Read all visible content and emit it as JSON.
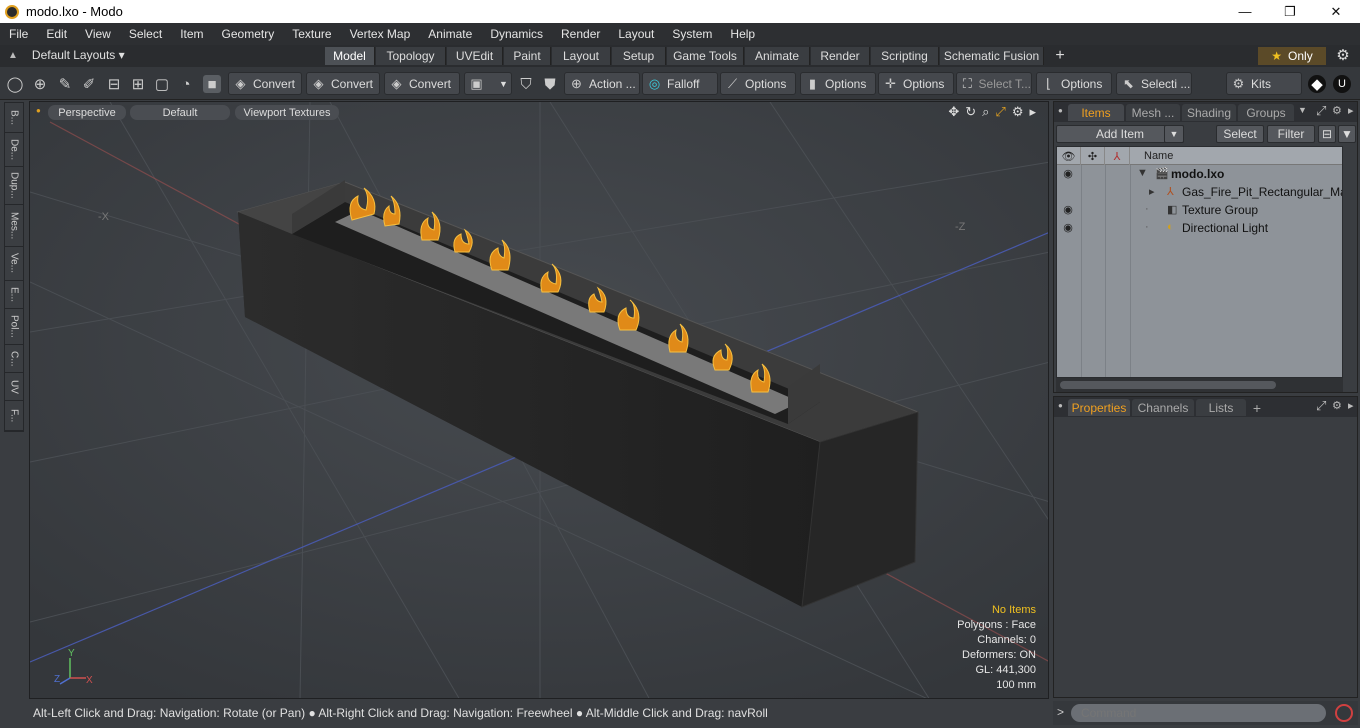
{
  "window": {
    "title": "modo.lxo - Modo",
    "minimize": "—",
    "maximize": "❐",
    "close": "✕"
  },
  "menu": [
    "File",
    "Edit",
    "View",
    "Select",
    "Item",
    "Geometry",
    "Texture",
    "Vertex Map",
    "Animate",
    "Dynamics",
    "Render",
    "Layout",
    "System",
    "Help"
  ],
  "layouts": {
    "selector": "Default Layouts ▾",
    "tabs": [
      "Model",
      "Topology",
      "UVEdit",
      "Paint",
      "Layout",
      "Setup",
      "Game Tools",
      "Animate",
      "Render",
      "Scripting",
      "Schematic Fusion",
      "+"
    ],
    "active": "Model",
    "only_label": "Only",
    "only_icon": "★"
  },
  "toolbar": {
    "convert1": "Convert",
    "convert2": "Convert",
    "convert3": "Convert",
    "action": "Action  ...",
    "falloff": "Falloff",
    "options1": "Options",
    "options2": "Options",
    "options3": "Options",
    "select_t": "Select T...",
    "options4": "Options",
    "selecti": "Selecti ...",
    "kits": "Kits"
  },
  "vtabs": [
    "B...",
    "De...",
    "Dup...",
    "Mes...",
    "Ve...",
    "E...",
    "Pol...",
    "C...",
    "UV",
    "F..."
  ],
  "viewport": {
    "view": "Perspective",
    "shading": "Default",
    "textures": "Viewport Textures",
    "axis_x_neg": "-X",
    "axis_z_neg": "-Z",
    "gizmo_y": "Y",
    "gizmo_x": "X",
    "gizmo_z": "Z",
    "info": {
      "no_items": "No Items",
      "polygons": "Polygons : Face",
      "channels": "Channels: 0",
      "deformers": "Deformers: ON",
      "gl": "GL: 441,300",
      "scale": "100 mm"
    }
  },
  "status": "Alt-Left Click and Drag: Navigation: Rotate (or Pan) ● Alt-Right Click and Drag: Navigation: Freewheel ● Alt-Middle Click and Drag: navRoll",
  "items_panel": {
    "tabs": [
      "Items",
      "Mesh ...",
      "Shading",
      "Groups"
    ],
    "add_item": "Add Item",
    "select": "Select",
    "filter": "Filter",
    "name_col": "Name",
    "rows": [
      {
        "name": "modo.lxo"
      },
      {
        "name": "Gas_Fire_Pit_Rectangular_Ma..."
      },
      {
        "name": "Texture Group"
      },
      {
        "name": "Directional Light"
      }
    ]
  },
  "properties_panel": {
    "tabs": [
      "Properties",
      "Channels",
      "Lists",
      "+"
    ]
  },
  "command": {
    "placeholder": "Command"
  },
  "colors": {
    "accent": "#f0a020",
    "tree_bg": "#8e9399"
  }
}
